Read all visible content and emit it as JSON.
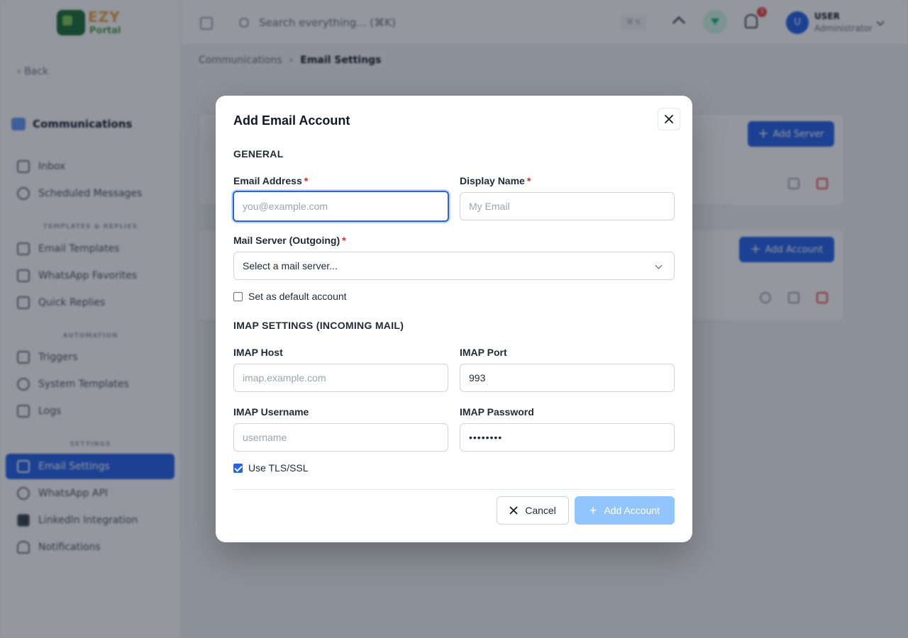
{
  "brand": {
    "logo_text": "EZY",
    "logo_sub": "Portal"
  },
  "sidebar": {
    "back_label": "Back",
    "section_title": "Communications",
    "items": [
      {
        "label": "Inbox",
        "icon": "inbox-icon"
      },
      {
        "label": "Scheduled Messages",
        "icon": "clock-icon"
      },
      {
        "label": "Email Templates",
        "icon": "document-icon"
      },
      {
        "label": "WhatsApp Favorites",
        "icon": "star-icon"
      },
      {
        "label": "Quick Replies",
        "icon": "message-icon"
      },
      {
        "label": "Triggers",
        "icon": "trigger-icon"
      },
      {
        "label": "System Templates",
        "icon": "gear-icon"
      },
      {
        "label": "Logs",
        "icon": "bar-chart-icon"
      },
      {
        "label": "Email Settings",
        "icon": "mail-icon"
      },
      {
        "label": "WhatsApp API",
        "icon": "whatsapp-icon"
      },
      {
        "label": "LinkedIn Integration",
        "icon": "linkedin-icon"
      },
      {
        "label": "Notifications",
        "icon": "bell-icon"
      }
    ],
    "groups": {
      "templates": "TEMPLATES & REPLIES",
      "automation": "AUTOMATION",
      "settings": "SETTINGS"
    },
    "active_item": "Email Settings"
  },
  "topbar": {
    "search_placeholder": "Search everything... (⌘K)",
    "shortcut": "⌘ K",
    "notification_count": "3",
    "user_initial": "U",
    "user_name": "USER",
    "user_role": "Administrator"
  },
  "breadcrumb": {
    "parent": "Communications",
    "separator": "›",
    "current": "Email Settings"
  },
  "page": {
    "add_server_label": "Add Server",
    "add_account_label": "Add Account"
  },
  "modal": {
    "title": "Add Email Account",
    "general_heading": "GENERAL",
    "email": {
      "label": "Email Address",
      "required": "*",
      "placeholder": "you@example.com",
      "value": ""
    },
    "display_name": {
      "label": "Display Name",
      "required": "*",
      "placeholder": "My Email",
      "value": ""
    },
    "mail_server": {
      "label": "Mail Server (Outgoing)",
      "required": "*",
      "selected": "Select a mail server..."
    },
    "default_account": {
      "label": "Set as default account",
      "checked": false
    },
    "imap_heading": "IMAP SETTINGS (INCOMING MAIL)",
    "imap_host": {
      "label": "IMAP Host",
      "placeholder": "imap.example.com",
      "value": ""
    },
    "imap_port": {
      "label": "IMAP Port",
      "value": "993"
    },
    "imap_username": {
      "label": "IMAP Username",
      "placeholder": "username",
      "value": ""
    },
    "imap_password": {
      "label": "IMAP Password",
      "value": "••••••••"
    },
    "tls": {
      "label": "Use TLS/SSL",
      "checked": true
    },
    "cancel_label": "Cancel",
    "submit_label": "Add Account"
  },
  "colors": {
    "accent": "#2563eb",
    "disabled_button": "#93c5fd",
    "required": "#dc2626"
  }
}
